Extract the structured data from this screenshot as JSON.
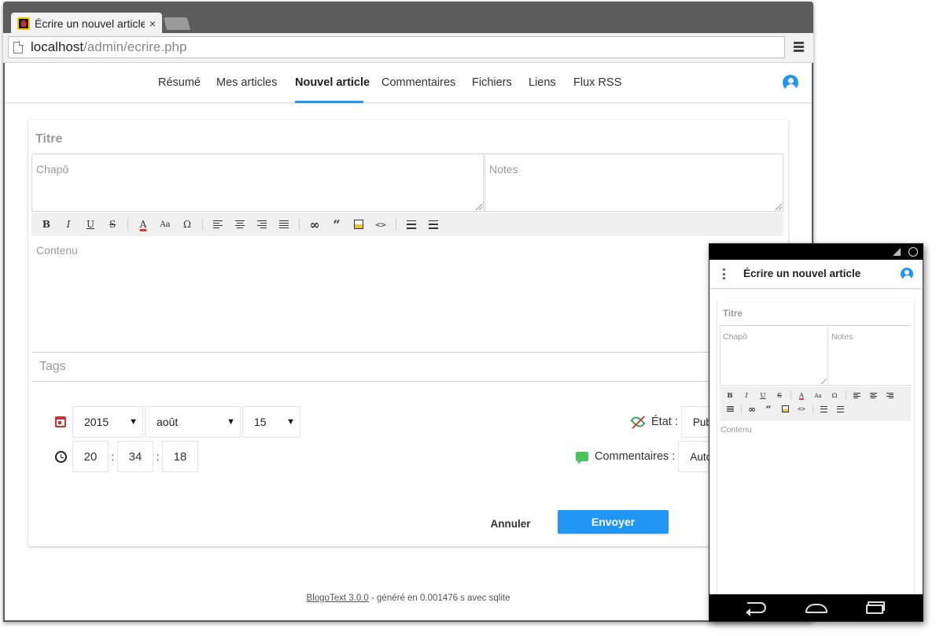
{
  "browser": {
    "tab_title": "Écrire un nouvel article",
    "tab_close": "×",
    "url_host": "localhost",
    "url_path": "/admin/ecrire.php"
  },
  "nav": {
    "items": [
      "Résumé",
      "Mes articles",
      "Nouvel article",
      "Commentaires",
      "Fichiers",
      "Liens",
      "Flux RSS"
    ],
    "active_index": 2
  },
  "form": {
    "title_placeholder": "Titre",
    "chapo_placeholder": "Chapô",
    "notes_placeholder": "Notes",
    "content_placeholder": "Contenu",
    "tags_placeholder": "Tags",
    "toolbar": {
      "bold": "B",
      "italic": "I",
      "underline": "U",
      "strike": "S",
      "color": "A",
      "size": "Aa",
      "omega": "Ω",
      "link": "∞",
      "quote": "“",
      "code": "<>"
    },
    "date": {
      "year": "2015",
      "month": "août",
      "day": "15"
    },
    "time": {
      "hour": "20",
      "minute": "34",
      "second": "18",
      "separator": ":"
    },
    "etat_label": "État :",
    "etat_value": "Publié",
    "comments_label": "Commentaires :",
    "comments_value": "Autorisés",
    "cancel_label": "Annuler",
    "submit_label": "Envoyer"
  },
  "footer": {
    "link": "BlogoText 3.0.0",
    "text": " - généré en 0.001476 s avec sqlite"
  },
  "mobile": {
    "title": "Écrire un nouvel article",
    "title_placeholder": "Titre",
    "chapo_placeholder": "Chapô",
    "notes_placeholder": "Notes",
    "content_placeholder": "Contenu"
  },
  "colors": {
    "accent": "#2196f3",
    "calendar_icon": "#d0302f",
    "comment_icon": "#49c45a"
  },
  "icons": [
    "page-icon",
    "menu-icon",
    "user-icon",
    "calendar-icon",
    "clock-icon",
    "eye-off-icon",
    "chat-icon",
    "back-icon",
    "home-icon",
    "recents-icon"
  ]
}
